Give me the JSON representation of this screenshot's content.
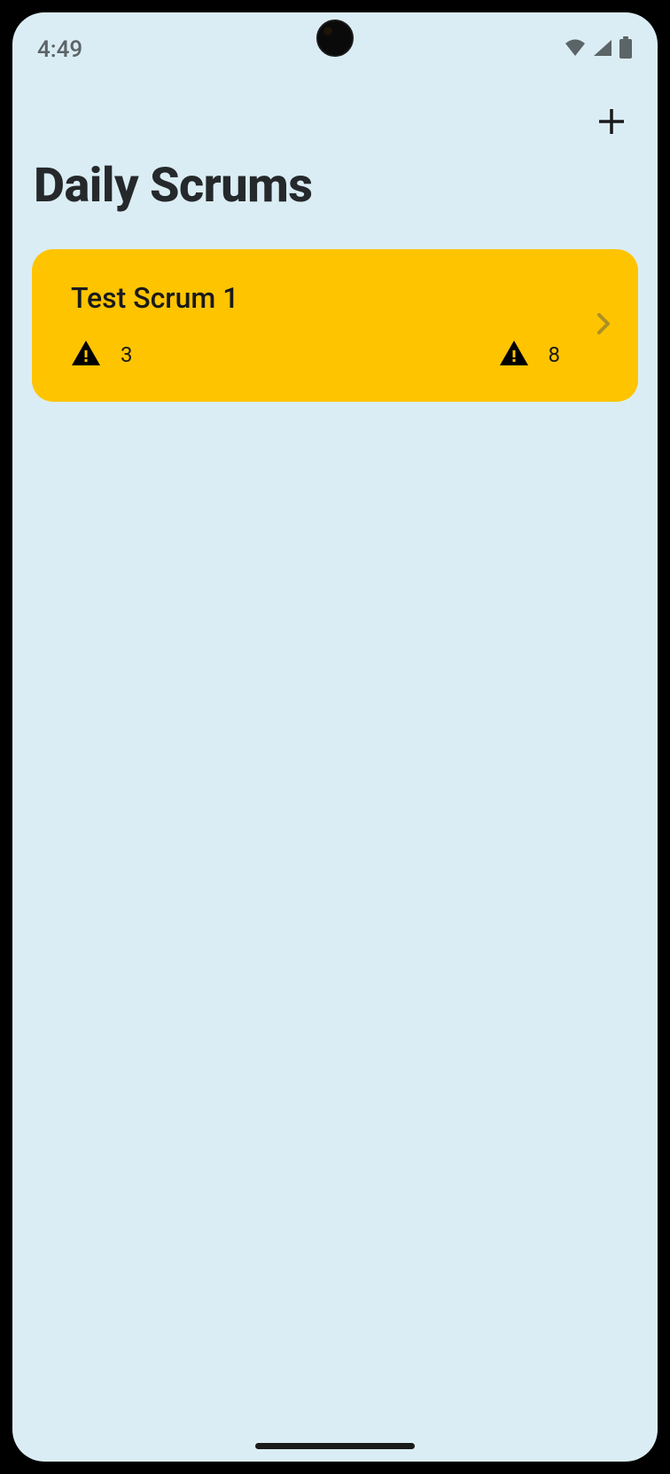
{
  "status_bar": {
    "time": "4:49"
  },
  "header": {
    "title": "Daily Scrums"
  },
  "scrums": [
    {
      "title": "Test Scrum 1",
      "stat1": "3",
      "stat2": "8"
    }
  ]
}
